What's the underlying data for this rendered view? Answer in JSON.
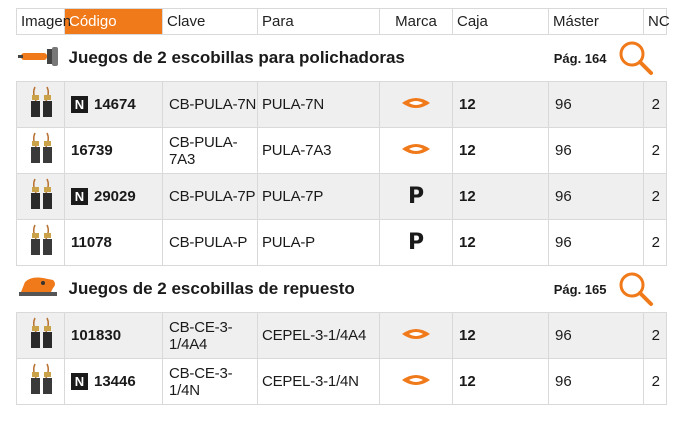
{
  "headers": {
    "imagen": "Imagen",
    "codigo": "Código",
    "clave": "Clave",
    "para": "Para",
    "marca": "Marca",
    "caja": "Caja",
    "master": "Máster",
    "nc": "NC"
  },
  "colors": {
    "accent": "#f07a1a",
    "row_grey": "#efefef"
  },
  "sections": [
    {
      "title": "Juegos de 2 escobillas para polichadoras",
      "page": "Pág. 164",
      "icon": "polisher-icon",
      "rows": [
        {
          "new_badge": "N",
          "codigo": "14674",
          "clave": "CB-PULA-7N",
          "para": "PULA-7N",
          "marca": "orange-logo",
          "caja": "12",
          "master": "96",
          "nc": "2"
        },
        {
          "new_badge": "",
          "codigo": "16739",
          "clave": "CB-PULA-7A3",
          "para": "PULA-7A3",
          "marca": "orange-logo",
          "caja": "12",
          "master": "96",
          "nc": "2"
        },
        {
          "new_badge": "N",
          "codigo": "29029",
          "clave": "CB-PULA-7P",
          "para": "PULA-7P",
          "marca": "P",
          "caja": "12",
          "master": "96",
          "nc": "2"
        },
        {
          "new_badge": "",
          "codigo": "11078",
          "clave": "CB-PULA-P",
          "para": "PULA-P",
          "marca": "P",
          "caja": "12",
          "master": "96",
          "nc": "2"
        }
      ]
    },
    {
      "title": "Juegos de 2 escobillas de repuesto",
      "page": "Pág. 165",
      "icon": "planer-icon",
      "rows": [
        {
          "new_badge": "",
          "codigo": "101830",
          "clave": "CB-CE-3-1/4A4",
          "para": "CEPEL-3-1/4A4",
          "marca": "orange-logo",
          "caja": "12",
          "master": "96",
          "nc": "2"
        },
        {
          "new_badge": "N",
          "codigo": "13446",
          "clave": "CB-CE-3-1/4N",
          "para": "CEPEL-3-1/4N",
          "marca": "orange-logo",
          "caja": "12",
          "master": "96",
          "nc": "2"
        }
      ]
    }
  ]
}
